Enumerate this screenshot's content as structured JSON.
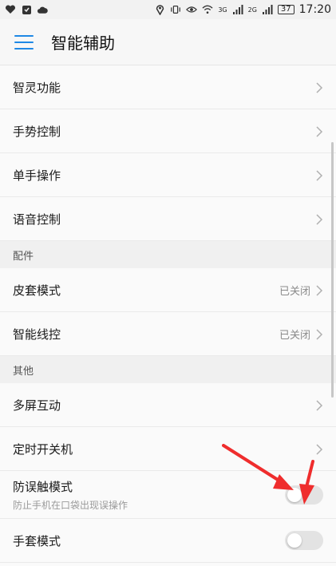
{
  "status_bar": {
    "left_icons": [
      "heart-icon",
      "message-icon",
      "cloud-icon"
    ],
    "right_icons": [
      "location-icon",
      "vibrate-icon",
      "eye-icon",
      "wifi-icon",
      "signal-3g-icon",
      "signal-2g-icon"
    ],
    "network_1": "3G",
    "network_2": "2G",
    "battery": "37",
    "time": "17:20"
  },
  "app_bar": {
    "title": "智能辅助",
    "menu_icon": "hamburger-icon"
  },
  "items_top": [
    {
      "label": "智灵功能"
    },
    {
      "label": "手势控制"
    },
    {
      "label": "单手操作"
    },
    {
      "label": "语音控制"
    }
  ],
  "section_accessory": {
    "header": "配件",
    "items": [
      {
        "label": "皮套模式",
        "status": "已关闭"
      },
      {
        "label": "智能线控",
        "status": "已关闭"
      }
    ]
  },
  "section_other": {
    "header": "其他",
    "items": [
      {
        "label": "多屏互动"
      },
      {
        "label": "定时开关机"
      }
    ],
    "toggle_items": [
      {
        "label": "防误触模式",
        "sub": "防止手机在口袋出现误操作",
        "on": false
      },
      {
        "label": "手套模式",
        "on": false
      }
    ]
  },
  "colors": {
    "accent": "#1e88e5",
    "annotation_arrow": "#ef2d2d"
  }
}
